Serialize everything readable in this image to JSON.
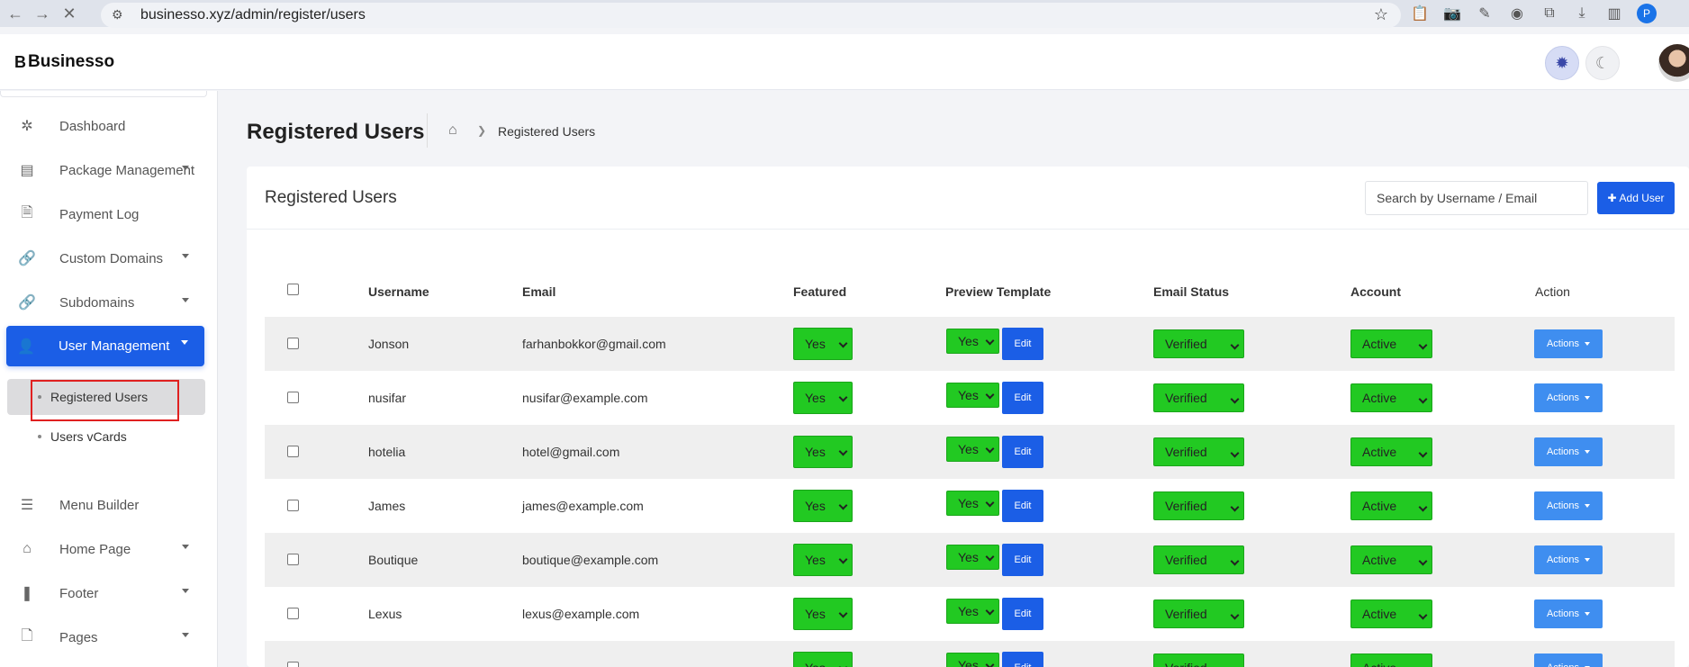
{
  "browser": {
    "url": "businesso.xyz/admin/register/users",
    "profile_initial": "P"
  },
  "header": {
    "logo_mark": "B",
    "logo_text": "Businesso"
  },
  "sidebar": {
    "items": [
      {
        "label": "Dashboard",
        "icon": "palette-icon",
        "glyph": "✲"
      },
      {
        "label": "Package Management",
        "icon": "receipt-icon",
        "glyph": "▤"
      },
      {
        "label": "Payment Log",
        "icon": "file-dollar-icon",
        "glyph": "🗎"
      },
      {
        "label": "Custom Domains",
        "icon": "link-icon",
        "glyph": "🔗"
      },
      {
        "label": "Subdomains",
        "icon": "link-icon",
        "glyph": "🔗"
      },
      {
        "label": "User Management",
        "icon": "users-icon",
        "glyph": "👤"
      },
      {
        "label": "Menu Builder",
        "icon": "menu-icon",
        "glyph": "☰"
      },
      {
        "label": "Home Page",
        "icon": "home-icon",
        "glyph": "⌂"
      },
      {
        "label": "Footer",
        "icon": "footer-icon",
        "glyph": "❚"
      },
      {
        "label": "Pages",
        "icon": "page-icon",
        "glyph": "🗋"
      }
    ],
    "sub_items": [
      {
        "label": "Registered Users"
      },
      {
        "label": "Users vCards"
      }
    ]
  },
  "page": {
    "title": "Registered Users",
    "breadcrumb_current": "Registered Users"
  },
  "card": {
    "title": "Registered Users",
    "search_placeholder": "Search by Username / Email",
    "add_button": "Add User",
    "columns": [
      "Username",
      "Email",
      "Featured",
      "Preview Template",
      "Email Status",
      "Account",
      "Action"
    ]
  },
  "table": {
    "rows": [
      {
        "username": "Jonson",
        "email": "farhanbokkor@gmail.com",
        "featured": "Yes",
        "preview": "Yes",
        "edit": "Edit",
        "email_status": "Verified",
        "account": "Active",
        "action": "Actions"
      },
      {
        "username": "nusifar",
        "email": "nusifar@example.com",
        "featured": "Yes",
        "preview": "Yes",
        "edit": "Edit",
        "email_status": "Verified",
        "account": "Active",
        "action": "Actions"
      },
      {
        "username": "hotelia",
        "email": "hotel@gmail.com",
        "featured": "Yes",
        "preview": "Yes",
        "edit": "Edit",
        "email_status": "Verified",
        "account": "Active",
        "action": "Actions"
      },
      {
        "username": "James",
        "email": "james@example.com",
        "featured": "Yes",
        "preview": "Yes",
        "edit": "Edit",
        "email_status": "Verified",
        "account": "Active",
        "action": "Actions"
      },
      {
        "username": "Boutique",
        "email": "boutique@example.com",
        "featured": "Yes",
        "preview": "Yes",
        "edit": "Edit",
        "email_status": "Verified",
        "account": "Active",
        "action": "Actions"
      },
      {
        "username": "Lexus",
        "email": "lexus@example.com",
        "featured": "Yes",
        "preview": "Yes",
        "edit": "Edit",
        "email_status": "Verified",
        "account": "Active",
        "action": "Actions"
      },
      {
        "username": "",
        "email": "",
        "featured": "Yes",
        "preview": "Yes",
        "edit": "Edit",
        "email_status": "Verified",
        "account": "Active",
        "action": "Actions"
      }
    ]
  }
}
